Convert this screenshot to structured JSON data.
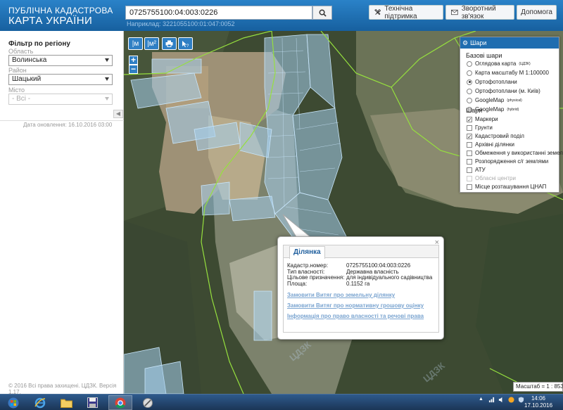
{
  "header": {
    "logo_line1": "ПУБЛІЧНА КАДАСТРОВА",
    "logo_line2": "КАРТА УКРАЇНИ",
    "search_value": "0725755100:04:003:0226",
    "search_hint": "Наприклад: 3221055100:01:047:0052",
    "support_label": "Технічна підтримка",
    "feedback_label": "Зворотний зв'язок",
    "help_label": "Допомога"
  },
  "sidebar": {
    "title": "Фільтр по регіону",
    "region_label": "Область",
    "region_value": "Волинська",
    "district_label": "Район",
    "district_value": "Шацький",
    "city_label": "Місто",
    "city_value": "- Всі -",
    "update_date": "Дата оновлення: 16.10.2016 03:00",
    "copyright": "© 2016 Всі права захищені. ЦДЗК. Версія 1.17."
  },
  "map_tools": {
    "measure_line": "|м",
    "measure_area": "|м²",
    "print": "print-icon",
    "info": "info-cursor-icon",
    "zoom_in": "+",
    "zoom_out": "−"
  },
  "layers": {
    "title": "Шари",
    "base_title": "Базові шари",
    "base": [
      {
        "label": "Оглядова карта",
        "sup": "(ЦДЗК)",
        "selected": false
      },
      {
        "label": "Карта масштабу М 1:100000",
        "sup": "",
        "selected": false
      },
      {
        "label": "Ортофотоплани",
        "sup": "",
        "selected": true
      },
      {
        "label": "Ортофотоплани (м. Київ)",
        "sup": "",
        "selected": false
      },
      {
        "label": "GoogleMap",
        "sup": "(physical)",
        "selected": false
      },
      {
        "label": "GoogleMap",
        "sup": "(hybrid)",
        "selected": false
      }
    ],
    "overlay_title": "Шари",
    "overlays": [
      {
        "label": "Маркери",
        "checked": true,
        "disabled": false
      },
      {
        "label": "Грунти",
        "checked": false,
        "disabled": false
      },
      {
        "label": "Кадастровий поділ",
        "checked": true,
        "disabled": false
      },
      {
        "label": "Архівні ділянки",
        "checked": false,
        "disabled": false
      },
      {
        "label": "Обмеження у використанні земель",
        "checked": false,
        "disabled": false
      },
      {
        "label": "Розпорядження с/г землями",
        "checked": false,
        "disabled": false
      },
      {
        "label": "АТУ",
        "checked": false,
        "disabled": false
      },
      {
        "label": "Обласні центри",
        "checked": false,
        "disabled": true
      },
      {
        "label": "Місце розташування ЦНАП",
        "checked": false,
        "disabled": false
      }
    ]
  },
  "popup": {
    "tab": "Ділянка",
    "close": "×",
    "rows": [
      {
        "key": "Кадастр.номер:",
        "value": "0725755100:04:003:0226"
      },
      {
        "key": "Тип власності:",
        "value": "Державна власність"
      },
      {
        "key": "Цільове призначення:",
        "value": "для індивідуального садівництва"
      },
      {
        "key": "Площа:",
        "value": "0.1152 га"
      }
    ],
    "links": [
      "Замовити Витяг про земельну ділянку",
      "Замовити Витяг про нормативну грошову оцінку",
      "Інформація про право власності та речові права"
    ]
  },
  "scale": "Масштаб = 1 : 8531",
  "taskbar": {
    "time": "14:06",
    "date": "17.10.2016"
  },
  "colors": {
    "header_blue": "#1f6db0",
    "parcel_fill": "#9fc8e6",
    "boundary_green": "#8fdc3c",
    "link_blue": "#7aa4d0"
  }
}
